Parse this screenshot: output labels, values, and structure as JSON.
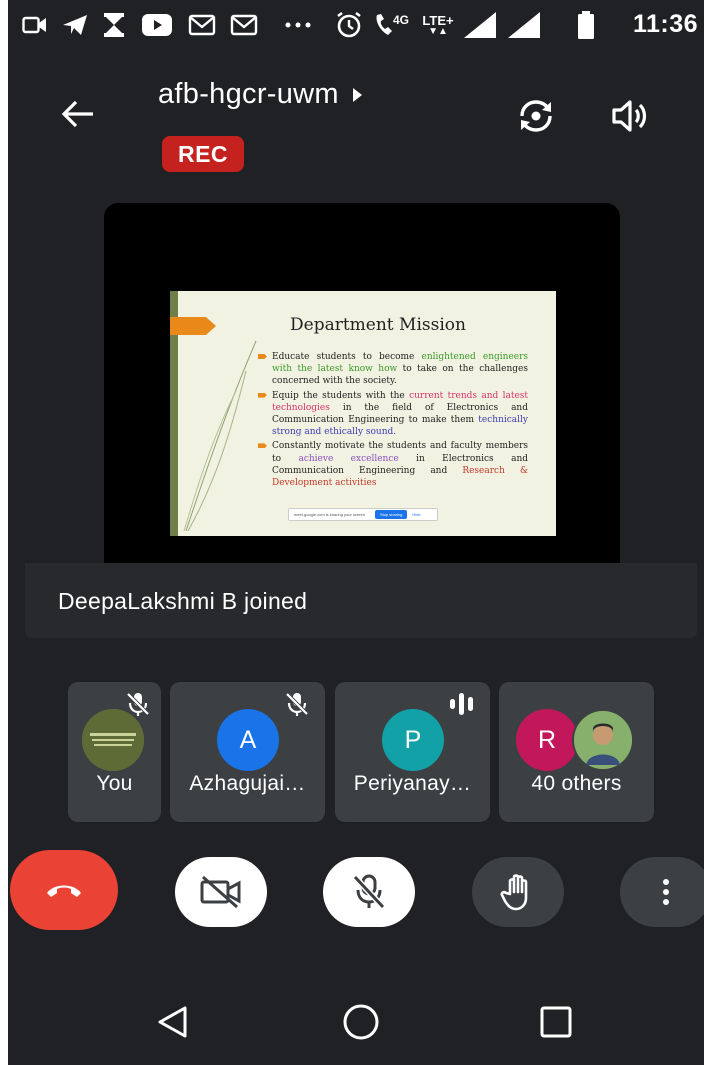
{
  "status_bar": {
    "time": "11:36",
    "network_label": "4G",
    "lte_label": "LTE+",
    "icons": [
      "video-notification-icon",
      "telegram-icon",
      "hourglass-icon",
      "youtube-icon",
      "gmail-icon",
      "gmail-icon",
      "more-dots-icon",
      "alarm-icon",
      "volte-call-icon",
      "lte-icon",
      "signal-icon",
      "signal-icon",
      "battery-icon"
    ]
  },
  "header": {
    "meeting_code": "afb-hgcr-uwm",
    "rec_label": "REC"
  },
  "presentation": {
    "slide_title": "Department Mission",
    "points": [
      {
        "segments": [
          {
            "text": "Educate students to become ",
            "style": ""
          },
          {
            "text": "enlightened engineers with the latest know how",
            "style": "c-green"
          },
          {
            "text": " to take on the challenges concerned with the society.",
            "style": ""
          }
        ]
      },
      {
        "segments": [
          {
            "text": "Equip the students with the ",
            "style": ""
          },
          {
            "text": "current trends and latest technologies",
            "style": "c-pink"
          },
          {
            "text": " in the field of Electronics and Communication Engineering to make them ",
            "style": ""
          },
          {
            "text": "technically strong and ethically sound.",
            "style": "c-blue"
          }
        ]
      },
      {
        "segments": [
          {
            "text": "Constantly motivate the students and faculty members to ",
            "style": ""
          },
          {
            "text": "achieve excellence",
            "style": "c-purple"
          },
          {
            "text": " in Electronics and Communication Engineering and ",
            "style": ""
          },
          {
            "text": "Research & Development activities",
            "style": "c-red"
          }
        ]
      }
    ],
    "share_bar": {
      "text": "meet.google.com is sharing your screen",
      "stop_label": "Stop sharing",
      "hide_label": "Hide"
    }
  },
  "toast": {
    "text": "DeepaLakshmi B joined"
  },
  "participants": [
    {
      "name": "You",
      "muted": true
    },
    {
      "name": "Azhagujai…",
      "initial": "A",
      "color": "#1a73e8",
      "muted": true
    },
    {
      "name": "Periyanay…",
      "initial": "P",
      "color": "#12a1a6",
      "speaking": true
    },
    {
      "name": "40 others",
      "initial": "R",
      "color": "#c2185b"
    }
  ],
  "controls": {
    "end_call": "end-call-icon",
    "camera": "camera-off-icon",
    "mic": "mic-off-icon",
    "hand": "raise-hand-icon",
    "more": "more-vert-icon"
  },
  "colors": {
    "background": "#202124",
    "rec": "#c5221f",
    "end_call": "#ea4335",
    "tile": "#3c4043"
  }
}
